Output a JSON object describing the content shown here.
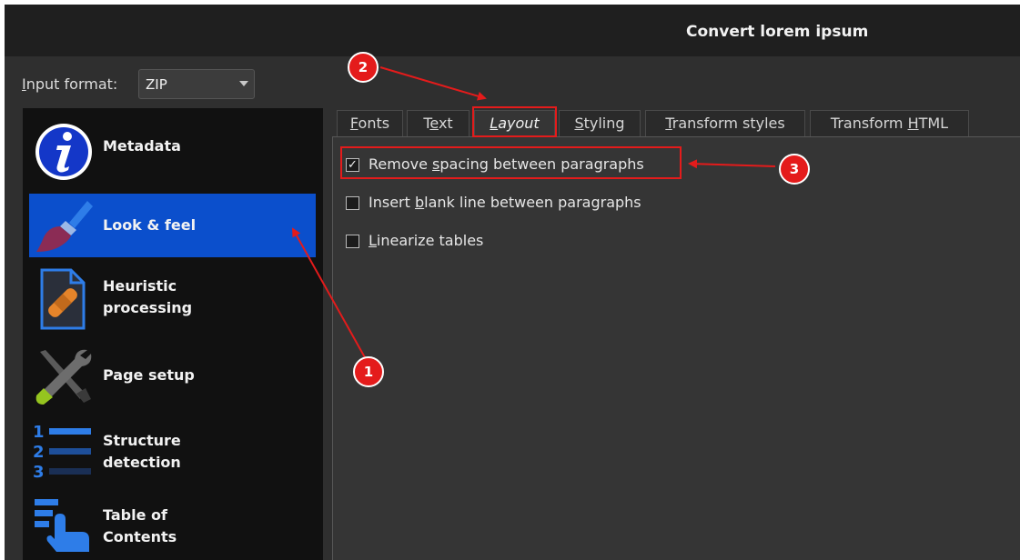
{
  "window": {
    "title": "Convert lorem ipsum"
  },
  "input_format": {
    "label_prefix": "I",
    "label_rest": "nput format:",
    "value": "ZIP"
  },
  "sidebar": {
    "items": [
      {
        "label_line1": "Metadata",
        "label_line2": "",
        "icon": "metadata-info-icon"
      },
      {
        "label_line1": "Look & feel",
        "label_line2": "",
        "icon": "paintbrush-icon"
      },
      {
        "label_line1": "Heuristic",
        "label_line2": "processing",
        "icon": "bandaid-document-icon"
      },
      {
        "label_line1": "Page setup",
        "label_line2": "",
        "icon": "tools-icon"
      },
      {
        "label_line1": "Structure",
        "label_line2": "detection",
        "icon": "numbered-list-icon"
      },
      {
        "label_line1": "Table of",
        "label_line2": "Contents",
        "icon": "toc-hand-icon"
      }
    ],
    "active_index": 1
  },
  "tabs": [
    {
      "pre": "",
      "u": "F",
      "post": "onts"
    },
    {
      "pre": "T",
      "u": "e",
      "post": "xt"
    },
    {
      "pre": "",
      "u": "L",
      "post": "ayout"
    },
    {
      "pre": "",
      "u": "S",
      "post": "tyling"
    },
    {
      "pre": "",
      "u": "T",
      "post": "ransform styles"
    },
    {
      "pre": "Transform ",
      "u": "H",
      "post": "TML"
    }
  ],
  "selected_tab_index": 2,
  "options": [
    {
      "pre": "Remove ",
      "u": "s",
      "post": "pacing between paragraphs",
      "checked": true,
      "mark": "✓"
    },
    {
      "pre": "Insert ",
      "u": "b",
      "post": "lank line between paragraphs",
      "checked": false,
      "mark": ""
    },
    {
      "pre": "",
      "u": "L",
      "post": "inearize tables",
      "checked": false,
      "mark": ""
    }
  ],
  "annotations": {
    "badge1": "1",
    "badge2": "2",
    "badge3": "3",
    "color": "#e41b1b"
  },
  "colors": {
    "accent_active": "#0b4fcc",
    "sidebar_bg": "#111111",
    "panel_bg": "#353535"
  }
}
